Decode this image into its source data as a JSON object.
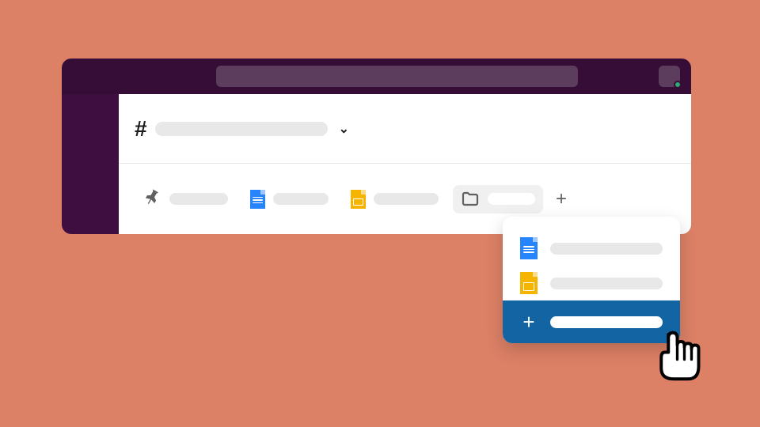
{
  "top_bar": {
    "search_placeholder": "",
    "presence": "active"
  },
  "channel": {
    "prefix": "#",
    "name_placeholder": ""
  },
  "bookmarks": {
    "items": [
      {
        "icon": "pin",
        "label": ""
      },
      {
        "icon": "doc-blue",
        "label": ""
      },
      {
        "icon": "doc-yellow",
        "label": ""
      },
      {
        "icon": "folder",
        "label": "",
        "active": true
      }
    ],
    "add_label": "+"
  },
  "dropdown": {
    "items": [
      {
        "icon": "doc-blue",
        "label": ""
      },
      {
        "icon": "doc-yellow",
        "label": ""
      }
    ],
    "add": {
      "label": "",
      "icon": "+"
    }
  },
  "colors": {
    "bg": "#DC8066",
    "purple_dark": "#350D36",
    "purple_sidebar": "#3F0E40",
    "accent_blue": "#1264A3",
    "doc_blue": "#2684FC",
    "doc_yellow": "#F4B400",
    "presence_green": "#2BAC76"
  }
}
